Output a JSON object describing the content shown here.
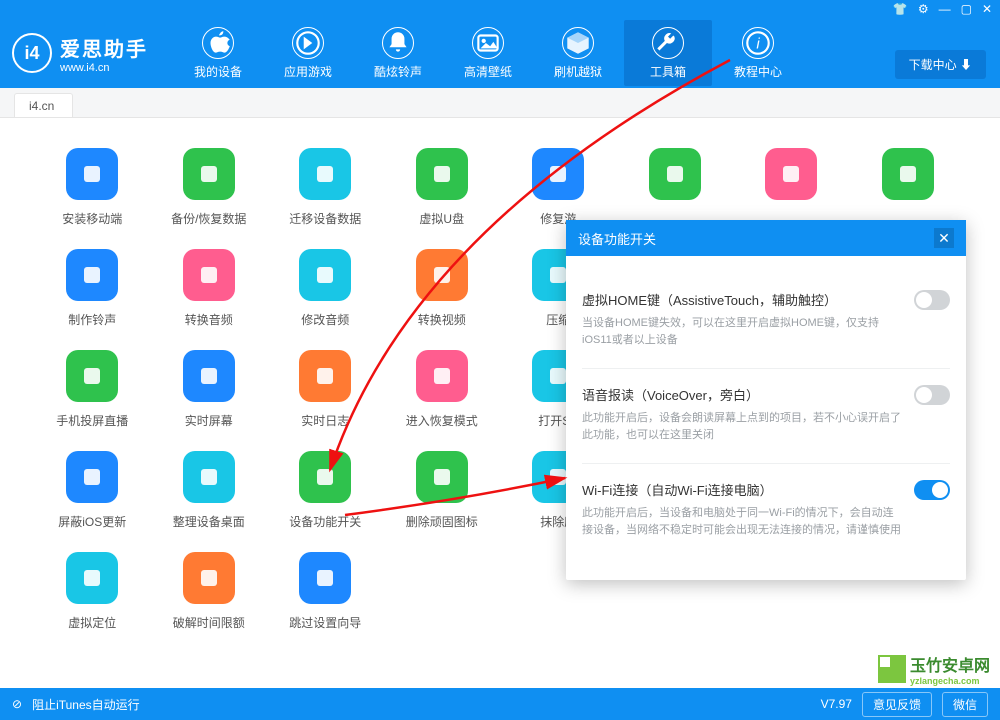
{
  "app": {
    "title": "爱思助手",
    "subtitle": "www.i4.cn"
  },
  "window_buttons": [
    "👕",
    "⚙",
    "—",
    "▢",
    "✕"
  ],
  "nav": [
    {
      "label": "我的设备",
      "icon": "apple"
    },
    {
      "label": "应用游戏",
      "icon": "app"
    },
    {
      "label": "酷炫铃声",
      "icon": "bell"
    },
    {
      "label": "高清壁纸",
      "icon": "image"
    },
    {
      "label": "刷机越狱",
      "icon": "box"
    },
    {
      "label": "工具箱",
      "icon": "wrench",
      "active": true
    },
    {
      "label": "教程中心",
      "icon": "info"
    }
  ],
  "download_center": "下载中心 ⬇",
  "tab": "i4.cn",
  "tools": [
    {
      "label": "安装移动端",
      "color": "#1e88ff",
      "icon": "logo"
    },
    {
      "label": "备份/恢复数据",
      "color": "#2fc24d",
      "icon": "restore"
    },
    {
      "label": "迁移设备数据",
      "color": "#19c6e6",
      "icon": "transfer"
    },
    {
      "label": "虚拟U盘",
      "color": "#2fc24d",
      "icon": "usb"
    },
    {
      "label": "修复游",
      "color": "#1e88ff",
      "icon": "appstore"
    },
    {
      "label": "",
      "color": "#2fc24d",
      "icon": "appleid"
    },
    {
      "label": "",
      "color": "#ff5d8f",
      "icon": "music"
    },
    {
      "label": "",
      "color": "#2fc24d",
      "icon": "cube"
    },
    {
      "label": "制作铃声",
      "color": "#1e88ff",
      "icon": "bell2"
    },
    {
      "label": "转换音频",
      "color": "#ff5d8f",
      "icon": "audio"
    },
    {
      "label": "修改音频",
      "color": "#19c6e6",
      "icon": "tune"
    },
    {
      "label": "转换视频",
      "color": "#ff7a33",
      "icon": "play"
    },
    {
      "label": "压缩",
      "color": "#19c6e6",
      "icon": "photo"
    },
    {
      "label": "",
      "color": "",
      "icon": ""
    },
    {
      "label": "",
      "color": "",
      "icon": ""
    },
    {
      "label": "",
      "color": "",
      "icon": ""
    },
    {
      "label": "手机投屏直播",
      "color": "#2fc24d",
      "icon": "screen"
    },
    {
      "label": "实时屏幕",
      "color": "#1e88ff",
      "icon": "monitor"
    },
    {
      "label": "实时日志",
      "color": "#ff7a33",
      "icon": "log"
    },
    {
      "label": "进入恢复模式",
      "color": "#ff5d8f",
      "icon": "phone"
    },
    {
      "label": "打开SS",
      "color": "#19c6e6",
      "icon": "ssh"
    },
    {
      "label": "",
      "color": "",
      "icon": ""
    },
    {
      "label": "",
      "color": "",
      "icon": ""
    },
    {
      "label": "",
      "color": "",
      "icon": ""
    },
    {
      "label": "屏蔽iOS更新",
      "color": "#1e88ff",
      "icon": "gear"
    },
    {
      "label": "整理设备桌面",
      "color": "#19c6e6",
      "icon": "grid"
    },
    {
      "label": "设备功能开关",
      "color": "#2fc24d",
      "icon": "switch"
    },
    {
      "label": "删除顽固图标",
      "color": "#2fc24d",
      "icon": "clock"
    },
    {
      "label": "抹除所",
      "color": "#19c6e6",
      "icon": "erase"
    },
    {
      "label": "",
      "color": "",
      "icon": ""
    },
    {
      "label": "",
      "color": "",
      "icon": ""
    },
    {
      "label": "",
      "color": "",
      "icon": ""
    },
    {
      "label": "虚拟定位",
      "color": "#19c6e6",
      "icon": "pin"
    },
    {
      "label": "破解时间限额",
      "color": "#ff7a33",
      "icon": "hour"
    },
    {
      "label": "跳过设置向导",
      "color": "#1e88ff",
      "icon": "skip"
    },
    {
      "label": "",
      "color": "",
      "icon": ""
    },
    {
      "label": "",
      "color": "",
      "icon": ""
    },
    {
      "label": "",
      "color": "",
      "icon": ""
    },
    {
      "label": "",
      "color": "",
      "icon": ""
    },
    {
      "label": "",
      "color": "",
      "icon": ""
    }
  ],
  "modal": {
    "title": "设备功能开关",
    "close": "✕",
    "options": [
      {
        "title": "虚拟HOME键（AssistiveTouch，辅助触控）",
        "desc": "当设备HOME键失效，可以在这里开启虚拟HOME键，仅支持iOS11或者以上设备",
        "on": false
      },
      {
        "title": "语音报读（VoiceOver，旁白）",
        "desc": "此功能开启后，设备会朗读屏幕上点到的项目，若不小心误开启了此功能，也可以在这里关闭",
        "on": false
      },
      {
        "title": "Wi-Fi连接（自动Wi-Fi连接电脑）",
        "desc": "此功能开启后，当设备和电脑处于同一Wi-Fi的情况下，会自动连接设备，当网络不稳定时可能会出现无法连接的情况，请谨慎使用",
        "on": true
      }
    ]
  },
  "footer": {
    "itunes": "阻止iTunes自动运行",
    "version": "V7.97",
    "feedback": "意见反馈",
    "wechat": "微信"
  },
  "watermark": "玉竹安卓网",
  "watermark_url": "yzlangecha.com"
}
